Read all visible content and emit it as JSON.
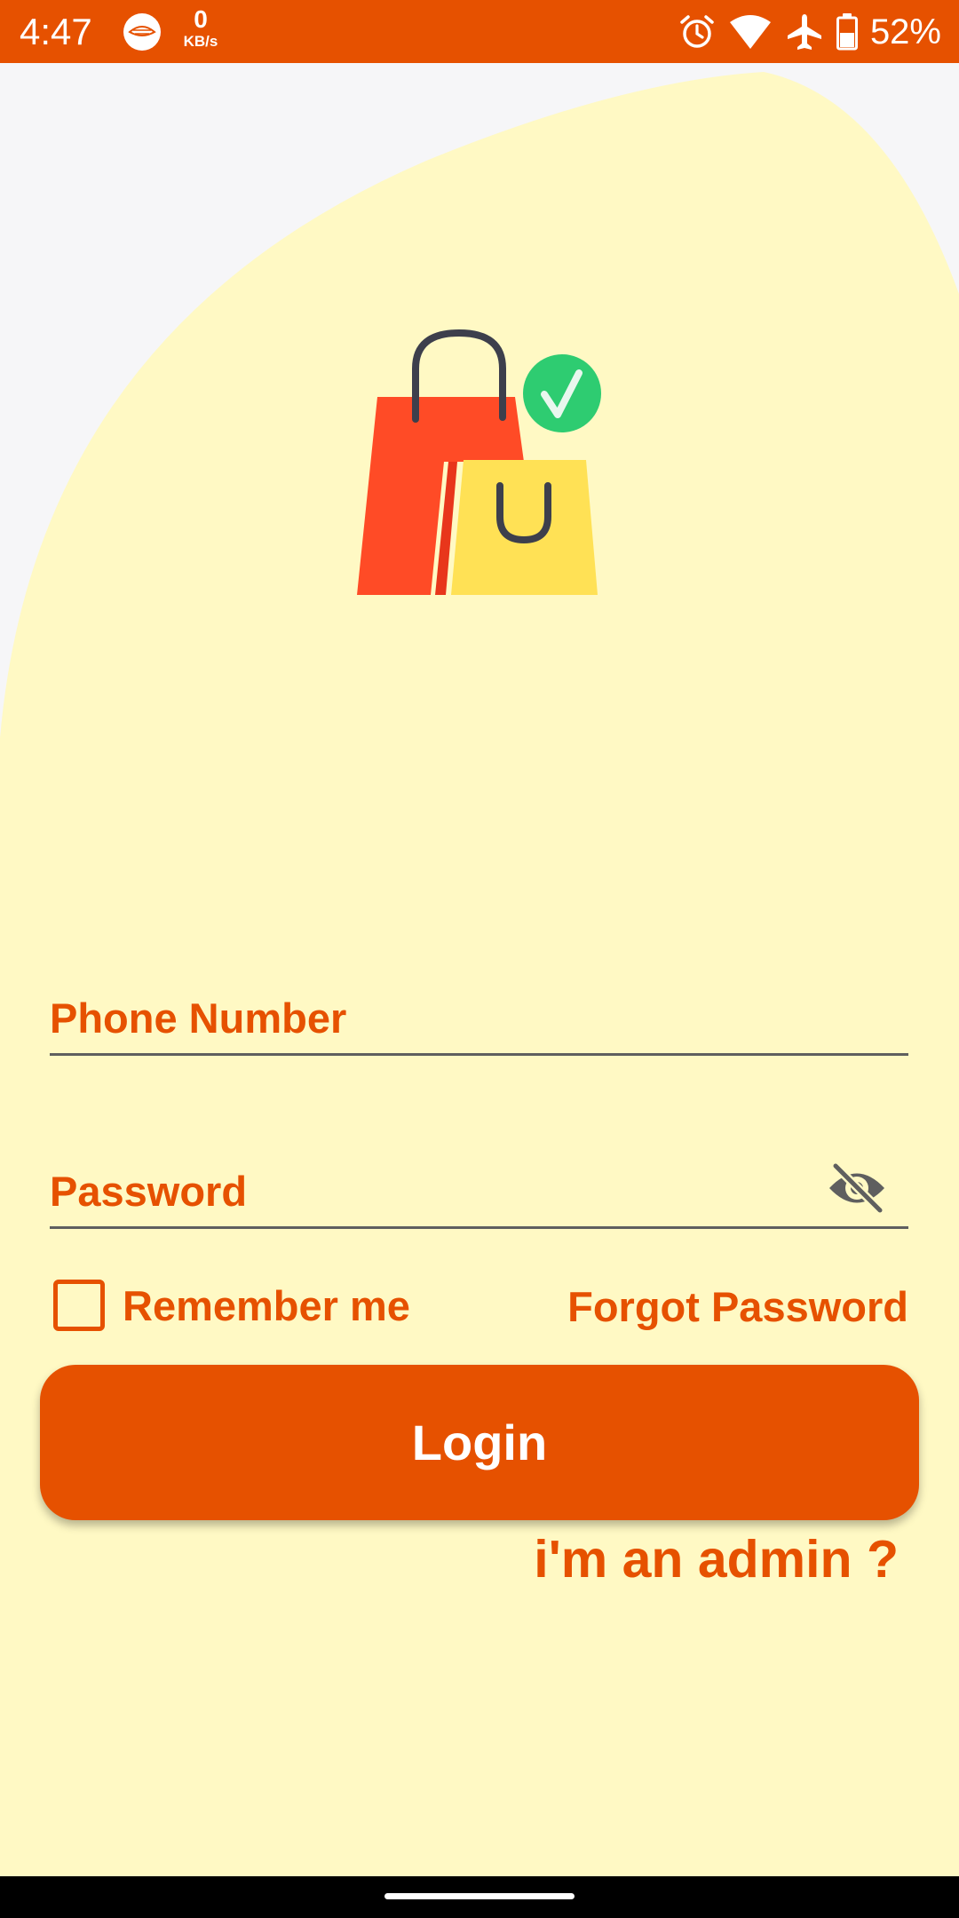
{
  "status_bar": {
    "time": "4:47",
    "app_icon": "watermelon-app-icon",
    "net_speed_value": "0",
    "net_speed_unit": "KB/s",
    "icons": [
      "alarm-icon",
      "wifi-icon",
      "airplane-mode-icon",
      "battery-icon"
    ],
    "battery_percent": "52%"
  },
  "login": {
    "logo_icon": "shopping-bags-check-icon",
    "phone_label": "Phone Number",
    "password_label": "Password",
    "password_toggle_icon": "eye-off-icon",
    "remember_label": "Remember me",
    "remember_checked": false,
    "forgot_label": "Forgot Password",
    "login_label": "Login",
    "admin_label": "i'm an admin ?"
  },
  "colors": {
    "accent": "#E65100",
    "background": "#FFF9C4",
    "page_corner": "#F6F6F8",
    "text_on_accent": "#FFFFFF"
  }
}
